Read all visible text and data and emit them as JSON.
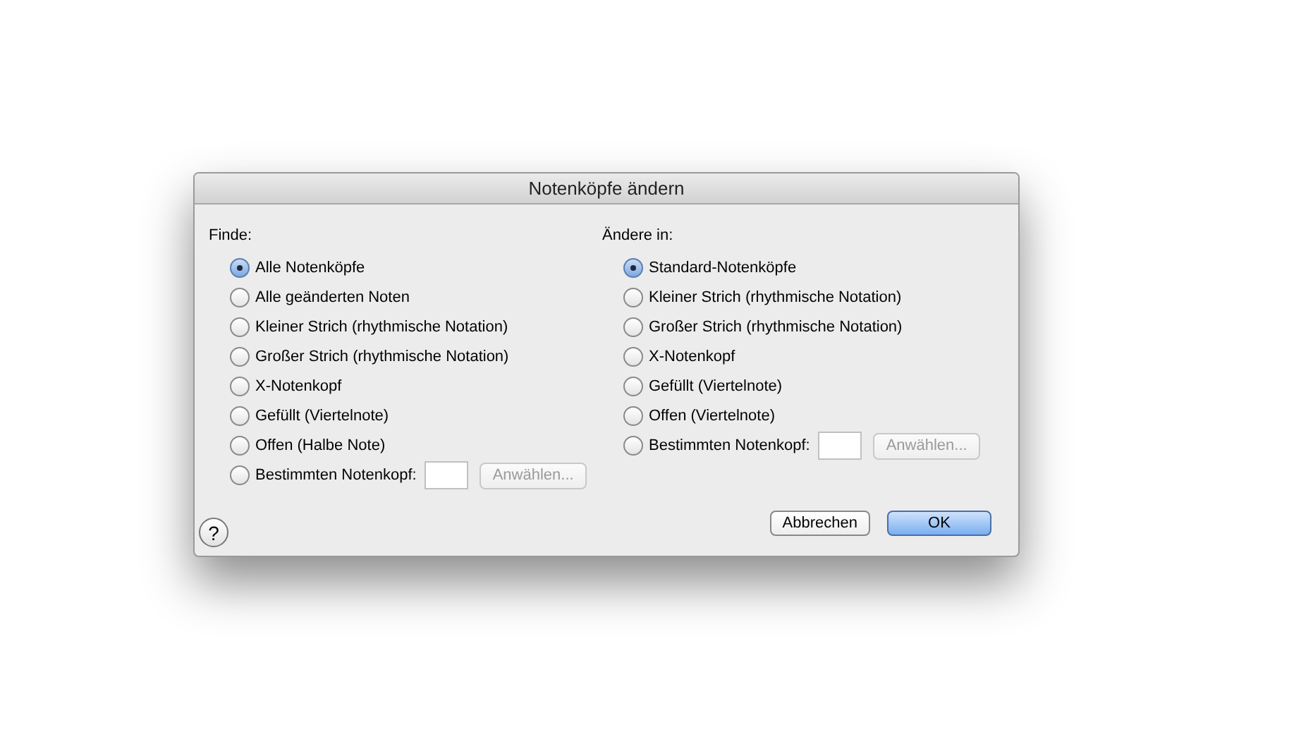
{
  "window": {
    "title": "Notenköpfe ändern"
  },
  "columns": [
    {
      "heading": "Finde:",
      "options": [
        {
          "kind": "plain",
          "label": "Alle Notenköpfe",
          "selected": true
        },
        {
          "kind": "plain",
          "label": "Alle geänderten Noten",
          "selected": false
        },
        {
          "kind": "plain",
          "label": "Kleiner Strich (rhythmische Notation)",
          "selected": false
        },
        {
          "kind": "plain",
          "label": "Großer Strich (rhythmische Notation)",
          "selected": false
        },
        {
          "kind": "plain",
          "label": "X-Notenkopf",
          "selected": false
        },
        {
          "kind": "plain",
          "label": "Gefüllt (Viertelnote)",
          "selected": false
        },
        {
          "kind": "plain",
          "label": "Offen (Halbe Note)",
          "selected": false
        },
        {
          "kind": "custom",
          "label": "Bestimmten Notenkopf:",
          "selected": false,
          "button": "Anwählen...",
          "disabled": true
        }
      ]
    },
    {
      "heading": "Ändere in:",
      "options": [
        {
          "kind": "plain",
          "label": "Standard-Notenköpfe",
          "selected": true
        },
        {
          "kind": "plain",
          "label": "Kleiner Strich (rhythmische Notation)",
          "selected": false
        },
        {
          "kind": "plain",
          "label": "Großer Strich (rhythmische Notation)",
          "selected": false
        },
        {
          "kind": "plain",
          "label": "X-Notenkopf",
          "selected": false
        },
        {
          "kind": "plain",
          "label": "Gefüllt (Viertelnote)",
          "selected": false
        },
        {
          "kind": "plain",
          "label": "Offen (Viertelnote)",
          "selected": false
        },
        {
          "kind": "custom",
          "label": "Bestimmten Notenkopf:",
          "selected": false,
          "button": "Anwählen...",
          "disabled": true
        }
      ]
    }
  ],
  "help": "?",
  "buttons": [
    {
      "kind": "cancel",
      "label": "Abbrechen"
    },
    {
      "kind": "default",
      "label": "OK"
    }
  ]
}
